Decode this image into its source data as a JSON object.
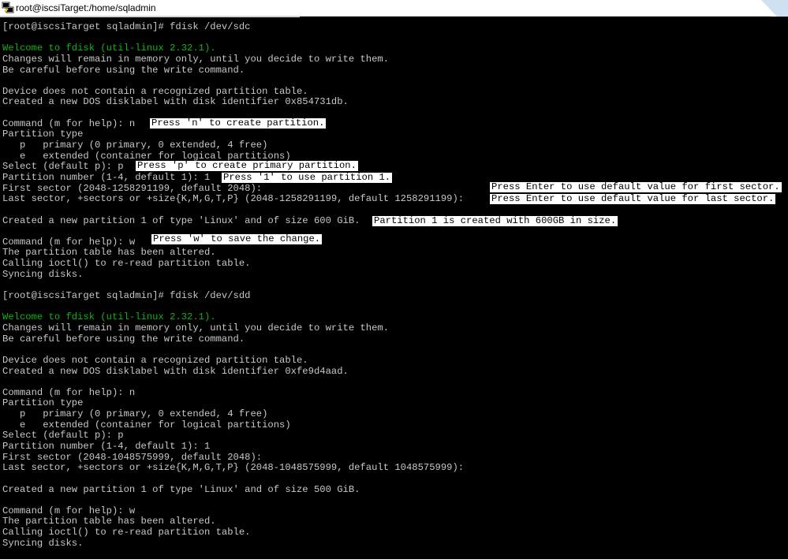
{
  "titlebar": {
    "title": "root@iscsiTarget:/home/sqladmin",
    "icon": "putty-terminal-icon"
  },
  "terminal": {
    "lines": [
      "[root@iscsiTarget sqladmin]# fdisk /dev/sdc",
      "",
      "Welcome to fdisk (util-linux 2.32.1).",
      "Changes will remain in memory only, until you decide to write them.",
      "Be careful before using the write command.",
      "",
      "Device does not contain a recognized partition table.",
      "Created a new DOS disklabel with disk identifier 0x854731db.",
      "",
      "Command (m for help): n",
      "Partition type",
      "   p   primary (0 primary, 0 extended, 4 free)",
      "   e   extended (container for logical partitions)",
      "Select (default p): p",
      "Partition number (1-4, default 1): 1",
      "First sector (2048-1258291199, default 2048):",
      "Last sector, +sectors or +size{K,M,G,T,P} (2048-1258291199, default 1258291199):",
      "",
      "Created a new partition 1 of type 'Linux' and of size 600 GiB.",
      "",
      "Command (m for help): w",
      "The partition table has been altered.",
      "Calling ioctl() to re-read partition table.",
      "Syncing disks.",
      "",
      "[root@iscsiTarget sqladmin]# fdisk /dev/sdd",
      "",
      "Welcome to fdisk (util-linux 2.32.1).",
      "Changes will remain in memory only, until you decide to write them.",
      "Be careful before using the write command.",
      "",
      "Device does not contain a recognized partition table.",
      "Created a new DOS disklabel with disk identifier 0xfe9d4aad.",
      "",
      "Command (m for help): n",
      "Partition type",
      "   p   primary (0 primary, 0 extended, 4 free)",
      "   e   extended (container for logical partitions)",
      "Select (default p): p",
      "Partition number (1-4, default 1): 1",
      "First sector (2048-1048575999, default 2048):",
      "Last sector, +sectors or +size{K,M,G,T,P} (2048-1048575999, default 1048575999):",
      "",
      "Created a new partition 1 of type 'Linux' and of size 500 GiB.",
      "",
      "Command (m for help): w",
      "The partition table has been altered.",
      "Calling ioctl() to re-read partition table.",
      "Syncing disks."
    ],
    "green_lines": [
      2,
      27
    ],
    "annotations": {
      "create_partition": "Press 'n' to create partition.",
      "primary_partition": "Press 'p' to create primary partition.",
      "partition_one": "Press '1' to use partition 1.",
      "first_sector": "Press Enter to use default value for first sector.",
      "last_sector": "Press Enter to use default value for last sector.",
      "partition_created": "Partition 1 is created with 600GB in size.",
      "save_change": "Press 'w' to save the change."
    }
  },
  "colors": {
    "background": "#000000",
    "text": "#c8c8c8",
    "green": "#12b212",
    "note_bg": "#ffffff",
    "note_text": "#000000"
  }
}
